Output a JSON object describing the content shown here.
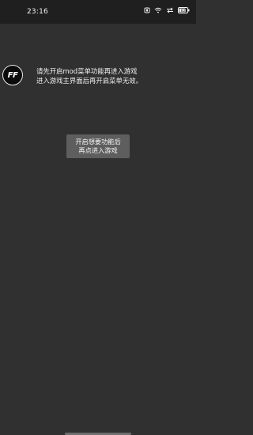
{
  "status_bar": {
    "time": "23:16",
    "icons": [
      "nfc-icon",
      "wifi-icon",
      "data-arrows-icon",
      "battery-icon"
    ],
    "battery_level": "82"
  },
  "app": {
    "logo_text": "FF"
  },
  "message": {
    "line1": "请先开启mod菜单功能再进入游戏",
    "line2": "进入游戏主界面后再开启菜单无效。"
  },
  "action_button": {
    "line1": "开启想要功能后",
    "line2": "再点进入游戏"
  },
  "colors": {
    "background": "#303030",
    "status_bar": "#1f1f1f",
    "button": "#5e5e5e",
    "text": "#ffffff"
  }
}
